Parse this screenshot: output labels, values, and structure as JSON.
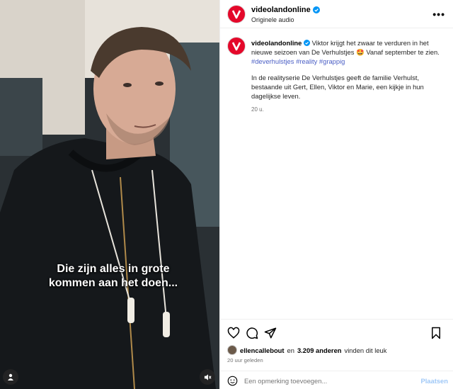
{
  "video": {
    "subtitle_line1": "Die zijn alles in grote",
    "subtitle_line2": "kommen aan het doen..."
  },
  "header": {
    "username": "videolandonline",
    "audio": "Originele audio",
    "more_label": "•••"
  },
  "caption": {
    "username": "videolandonline",
    "text1": "Viktor krijgt het zwaar te verduren in het nieuwe seizoen van De Verhulstjes",
    "emoji": "🤩",
    "text2": "Vanaf september te zien.",
    "hashtags": [
      "#deverhulstjes",
      "#reality",
      "#grappig"
    ],
    "paragraph2": "In de realityserie De Verhulstjes geeft de familie Verhulst, bestaande uit Gert, Ellen, Viktor en Marie, een kijkje in hun dagelijkse leven.",
    "time": "20 u."
  },
  "likes": {
    "user": "ellencallebout",
    "middle": "en",
    "count": "3.209 anderen",
    "suffix": "vinden dit leuk"
  },
  "posted_ago": "20 uur geleden",
  "comment": {
    "placeholder": "Een opmerking toevoegen...",
    "post_label": "Plaatsen"
  },
  "colors": {
    "brand": "#e4082a",
    "hashtag": "#4a5ec5",
    "post_disabled": "#9fc8f7",
    "verified": "#0095f6"
  }
}
